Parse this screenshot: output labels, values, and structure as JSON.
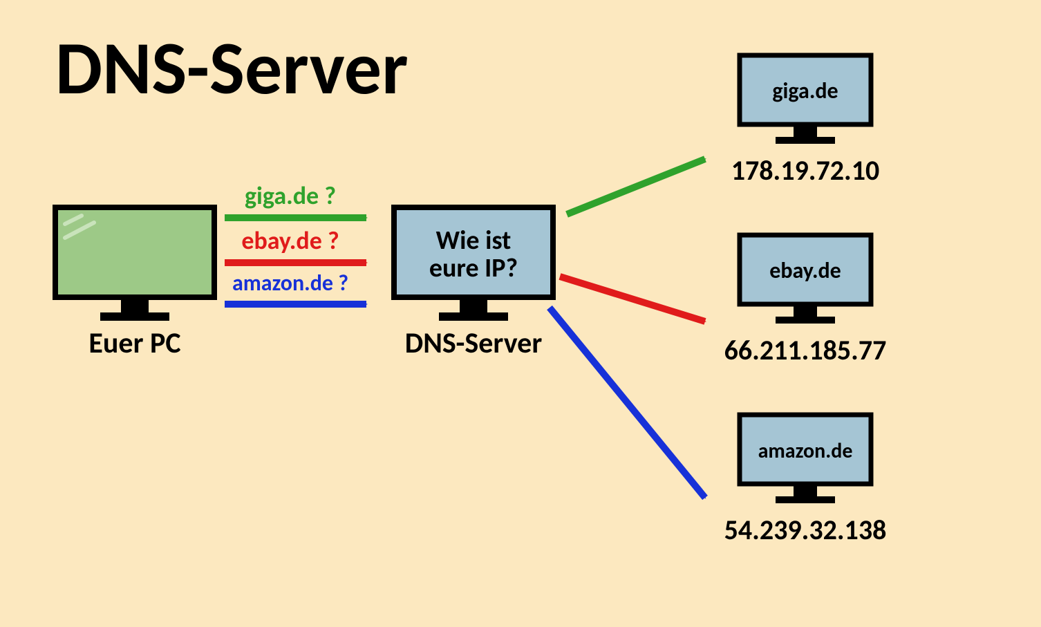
{
  "title": "DNS-Server",
  "client": {
    "label": "Euer PC"
  },
  "dns_server": {
    "label": "DNS-Server",
    "screen_line1": "Wie ist",
    "screen_line2": "eure IP?"
  },
  "queries": [
    {
      "key": "giga",
      "text": "giga.de ?",
      "color": "#2fa22c"
    },
    {
      "key": "ebay",
      "text": "ebay.de ?",
      "color": "#e01b1b"
    },
    {
      "key": "amazon",
      "text": "amazon.de ?",
      "color": "#1731d8"
    }
  ],
  "targets": [
    {
      "key": "giga",
      "domain": "giga.de",
      "ip": "178.19.72.10",
      "color": "#2fa22c"
    },
    {
      "key": "ebay",
      "domain": "ebay.de",
      "ip": "66.211.185.77",
      "color": "#e01b1b"
    },
    {
      "key": "amazon",
      "domain": "amazon.de",
      "ip": "54.239.32.138",
      "color": "#1731d8"
    }
  ],
  "palette": {
    "bg": "#fce8bf",
    "pc_screen": "#9dc987",
    "server_screen": "#a5c5d4",
    "stroke": "#000000"
  }
}
